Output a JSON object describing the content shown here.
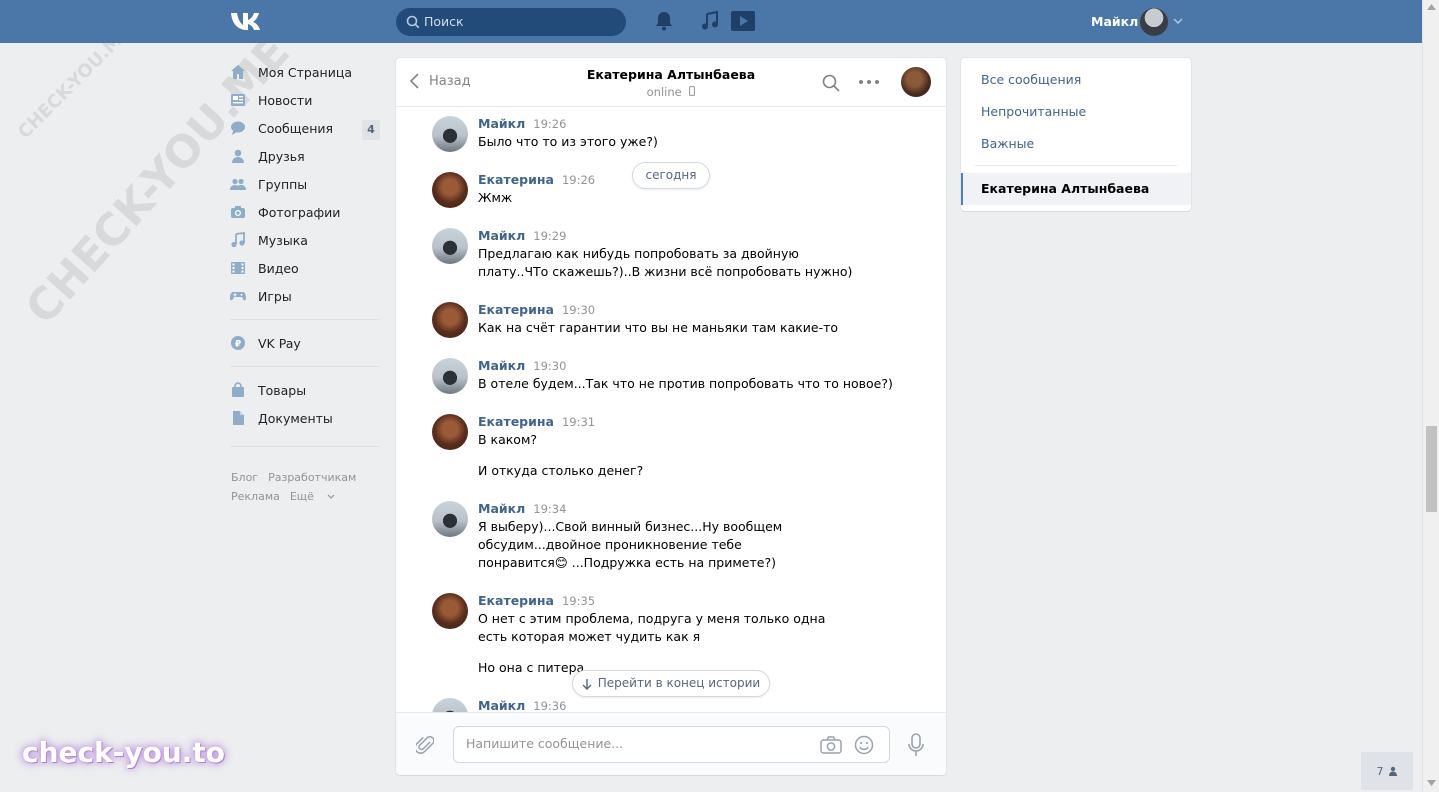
{
  "topbar": {
    "search_placeholder": "Поиск",
    "user_name": "Майкл"
  },
  "left_menu": {
    "items": [
      {
        "label": "Моя Страница",
        "icon": "home-icon"
      },
      {
        "label": "Новости",
        "icon": "news-icon"
      },
      {
        "label": "Сообщения",
        "icon": "messages-icon",
        "badge": "4"
      },
      {
        "label": "Друзья",
        "icon": "friends-icon"
      },
      {
        "label": "Группы",
        "icon": "groups-icon"
      },
      {
        "label": "Фотографии",
        "icon": "camera-icon"
      },
      {
        "label": "Музыка",
        "icon": "music-icon"
      },
      {
        "label": "Видео",
        "icon": "video-icon"
      },
      {
        "label": "Игры",
        "icon": "gamepad-icon"
      }
    ],
    "vkpay": "VK Pay",
    "extra": [
      {
        "label": "Товары",
        "icon": "bag-icon"
      },
      {
        "label": "Документы",
        "icon": "document-icon"
      }
    ],
    "footer": [
      "Блог",
      "Разработчикам",
      "Реклама",
      "Ещё"
    ]
  },
  "chat": {
    "back_label": "Назад",
    "peer_name": "Екатерина Алтынбаева",
    "peer_status": "online",
    "today_label": "сегодня",
    "scroll_end_label": "Перейти в конец истории",
    "input_placeholder": "Напишите сообщение...",
    "messages": [
      {
        "author": "Майкл",
        "time": "19:26",
        "lines": [
          "Было что то из этого уже?)"
        ]
      },
      {
        "author": "Екатерина",
        "time": "19:26",
        "lines": [
          "Жмж"
        ]
      },
      {
        "author": "Майкл",
        "time": "19:29",
        "lines": [
          "Предлагаю как нибудь попробовать за двойную плату..ЧТо скажешь?)..В жизни всё попробовать нужно)"
        ]
      },
      {
        "author": "Екатерина",
        "time": "19:30",
        "lines": [
          "Как на счёт гарантии что вы не маньяки там какие-то"
        ]
      },
      {
        "author": "Майкл",
        "time": "19:30",
        "lines": [
          "В отеле будем...Так что не против попробовать что то новое?)"
        ]
      },
      {
        "author": "Екатерина",
        "time": "19:31",
        "lines": [
          "В каком?"
        ],
        "extra": "И откуда столько денег?"
      },
      {
        "author": "Майкл",
        "time": "19:34",
        "lines": [
          "Я выберу)...Свой винный бизнес...Ну вообщем обсудим...двойное проникновение тебе понравится😊 ...Подружка есть на примете?)"
        ]
      },
      {
        "author": "Екатерина",
        "time": "19:35",
        "lines": [
          "О нет с этим проблема, подруга у меня только одна есть которая может чудить как я"
        ],
        "extra": "Но она с питера"
      },
      {
        "author": "Майкл",
        "time": "19:36",
        "lines": [
          ""
        ]
      }
    ]
  },
  "right_panel": {
    "all": "Все сообщения",
    "unread": "Непрочитанные",
    "important": "Важные",
    "active": "Екатерина Алтынбаева"
  },
  "online_count": "7",
  "watermark": "CHECK-YOU.ME",
  "watermark_small": "CHECK-YOU.ME",
  "brand": "check-you.to",
  "colors": {
    "header": "#4a76a8",
    "link": "#42648b",
    "bg": "#edeef0"
  }
}
